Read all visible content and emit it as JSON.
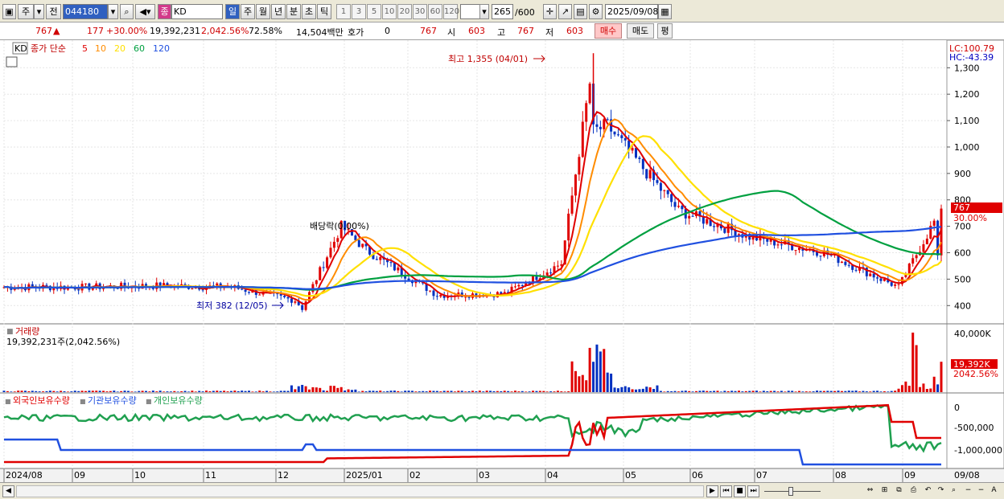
{
  "toolbar": {
    "period_prefix": "주",
    "prev_label": "전",
    "code": "044180",
    "market_badge": "종",
    "name": "KD",
    "period_tabs": [
      "일",
      "주",
      "월",
      "년",
      "분",
      "초",
      "틱"
    ],
    "active_period": "일",
    "intervals": [
      "1",
      "3",
      "5",
      "10",
      "20",
      "30",
      "60",
      "120"
    ],
    "count": "265",
    "count_total": "/600",
    "date": "2025/09/08"
  },
  "info": {
    "price": "767",
    "change": "177",
    "change_rate": "+30.00%",
    "volume": "19,392,231",
    "volume_rate": "2,042.56%",
    "turnover": "72.58%",
    "amount": "14,504백만",
    "quote_label": "호가",
    "quote_value": "0",
    "quote_price": "767",
    "open_label": "시",
    "open": "603",
    "high_label": "고",
    "high": "767",
    "low_label": "저",
    "low": "603",
    "buy_label": "매수",
    "sell_label": "매도",
    "eval_label": "평"
  },
  "price_panel": {
    "title": "KD",
    "ma_label": "종가 단순",
    "ma_periods": [
      "5",
      "10",
      "20",
      "60",
      "120"
    ],
    "ma_colors": [
      "#e00000",
      "#ff8c00",
      "#ffe000",
      "#00a040",
      "#2050e0"
    ],
    "lc": "LC:100.79",
    "hc": "HC:-43.39",
    "high_annotation": "최고 1,355 (04/01)",
    "low_annotation": "최저 382 (12/05)",
    "ex_rights": "배당락(0.00%)",
    "current_tag": "767",
    "current_rate_tag": "30.00%"
  },
  "volume_panel": {
    "title": "거래량",
    "current_text": "19,392,231주(2,042.56%)",
    "max_tick": "40,000K",
    "tag_value": "19,392K",
    "tag_rate": "2042.56%"
  },
  "holding_panel": {
    "legend": [
      "외국인보유수량",
      "기관보유수량",
      "개인보유수량"
    ],
    "legend_colors": [
      "#e00000",
      "#2050e0",
      "#20a050"
    ],
    "ticks": [
      "0",
      "-500,000",
      "-1,000,000"
    ]
  },
  "x_axis": {
    "labels": [
      "2024/08",
      "09",
      "10",
      "11",
      "12",
      "2025/01",
      "02",
      "03",
      "04",
      "05",
      "06",
      "07",
      "08",
      "09"
    ],
    "right_label": "09/08"
  },
  "chart_data": {
    "type": "candlestick",
    "y_axis": {
      "ticks": [
        1300,
        1200,
        1100,
        1000,
        900,
        800,
        700,
        600,
        500,
        400
      ],
      "range": [
        340,
        1380
      ]
    },
    "months": [
      "2024/08",
      "09",
      "10",
      "11",
      "12",
      "2025/01",
      "02",
      "03",
      "04",
      "05",
      "06",
      "07",
      "08",
      "09"
    ],
    "anchors": [
      {
        "month": "2024/08",
        "close": 470
      },
      {
        "month": "09",
        "close": 470
      },
      {
        "month": "10",
        "close": 475
      },
      {
        "month": "11",
        "close": 470
      },
      {
        "month": "12",
        "close": 420
      },
      {
        "date": "12/05",
        "low": 382
      },
      {
        "month": "12-mid",
        "close": 700
      },
      {
        "month": "2025/01",
        "close": 610
      },
      {
        "month": "02",
        "close": 440
      },
      {
        "month": "03",
        "close": 445
      },
      {
        "month": "03-end",
        "close": 560
      },
      {
        "date": "04/01",
        "high": 1355
      },
      {
        "month": "04",
        "close": 1060
      },
      {
        "month": "05",
        "close": 760
      },
      {
        "month": "06",
        "close": 660
      },
      {
        "month": "07",
        "close": 600
      },
      {
        "month": "08",
        "close": 470
      },
      {
        "month": "09",
        "close": 620
      },
      {
        "date": "09/08",
        "close": 767
      }
    ],
    "volume": {
      "max": 40000,
      "unit": "K",
      "last": 19392
    }
  }
}
